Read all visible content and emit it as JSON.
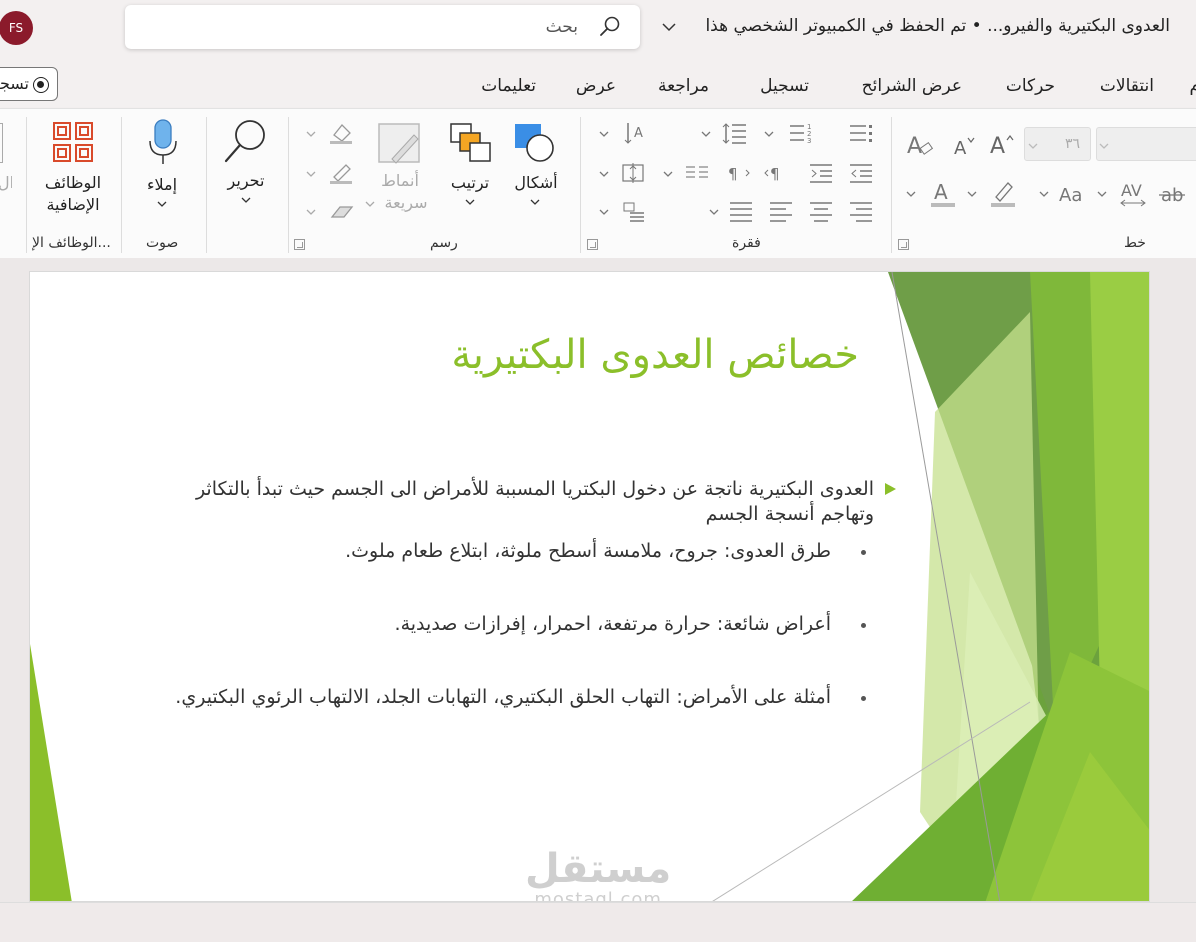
{
  "titlebar": {
    "avatar_initials": "FS",
    "search_placeholder": "بحث",
    "doc_title": "العدوى البكتيرية والفيرو... • تم الحفظ في الكمبيوتر الشخصي هذا"
  },
  "tabs": {
    "record_label": "تسجيل",
    "items": [
      "م",
      "انتقالات",
      "حركات",
      "عرض الشرائح",
      "تسجيل",
      "مراجعة",
      "عرض",
      "تعليمات"
    ]
  },
  "ribbon": {
    "font_group_label": "خط",
    "font_size_value": "٣٦",
    "paragraph_group_label": "فقرة",
    "drawing_group_label": "رسم",
    "shapes_label": "أشكال",
    "arrange_label": "ترتيب",
    "quick_styles_label_1": "أنماط",
    "quick_styles_label_2": "سريعة",
    "editing_label": "تحرير",
    "dictate_label": "إملاء",
    "voice_group_label": "صوت",
    "addins_label_1": "الوظائف",
    "addins_label_2": "الإضافية",
    "addins_group_label": "الوظائف الإ...",
    "cut_off_label": "ال"
  },
  "slide": {
    "title": "خصائص العدوى البكتيرية",
    "main_bullet": "العدوى البكتيرية ناتجة عن دخول البكتريا المسببة للأمراض الى الجسم حيث تبدأ بالتكاثر وتهاجم أنسجة الجسم",
    "sub_bullets": [
      "طرق العدوى: جروح، ملامسة أسطح ملوثة، ابتلاع طعام ملوث.",
      "أعراض شائعة: حرارة مرتفعة، احمرار، إفرازات صديدية.",
      "أمثلة على الأمراض: التهاب الحلق البكتيري، التهابات الجلد، الالتهاب الرئوي البكتيري."
    ],
    "accent_color": "#8bbf2a"
  },
  "watermark": {
    "arabic": "مستقل",
    "latin": "mostaql.com"
  },
  "icons": [
    "search-icon",
    "chevron-down-icon",
    "record-icon",
    "shapes-icon",
    "arrange-icon",
    "quick-styles-icon",
    "find-icon",
    "microphone-icon",
    "addins-icon"
  ]
}
